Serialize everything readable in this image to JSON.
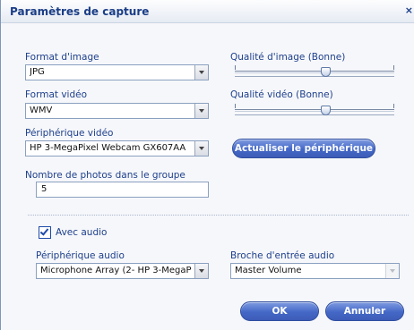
{
  "dialog": {
    "title": "Paramètres de capture",
    "close_glyph": "×"
  },
  "image_format": {
    "label": "Format d'image",
    "value": "JPG"
  },
  "image_quality": {
    "label": "Qualité d'image",
    "level": "(Bonne)",
    "position": 0.57
  },
  "video_format": {
    "label": "Format vidéo",
    "value": "WMV"
  },
  "video_quality": {
    "label": "Qualité vidéo",
    "level": "(Bonne)",
    "position": 0.57
  },
  "video_device": {
    "label": "Périphérique vidéo",
    "value": "HP 3-MegaPixel Webcam GX607AA"
  },
  "refresh_button": {
    "label": "Actualiser le périphérique"
  },
  "photo_count": {
    "label": "Nombre de photos dans le groupe",
    "value": "5"
  },
  "audio": {
    "checkbox_label": "Avec audio",
    "checked": true,
    "device_label": "Périphérique audio",
    "device_value": "Microphone Array (2- HP 3-MegaP",
    "input_label": "Broche d'entrée audio",
    "input_value": "Master Volume"
  },
  "buttons": {
    "ok": "OK",
    "cancel": "Annuler"
  },
  "colors": {
    "label_blue": "#1d3f8c",
    "button_blue": "#4468c7"
  }
}
